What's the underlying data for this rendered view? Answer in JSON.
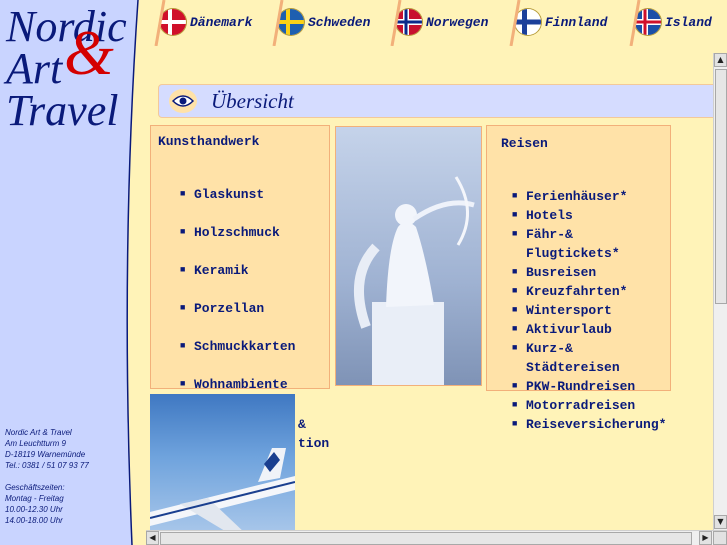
{
  "logo": {
    "line1": "Nordic",
    "line2": "Art",
    "ampersand": "&",
    "line3": "Travel"
  },
  "tabs": [
    {
      "label": "Dänemark",
      "flag": "denmark-flag-icon"
    },
    {
      "label": "Schweden",
      "flag": "sweden-flag-icon"
    },
    {
      "label": "Norwegen",
      "flag": "norway-flag-icon"
    },
    {
      "label": "Finnland",
      "flag": "finland-flag-icon"
    },
    {
      "label": "Island",
      "flag": "iceland-flag-icon"
    }
  ],
  "page_title": "Übersicht",
  "kunsthandwerk": {
    "heading": "Kunsthandwerk",
    "items": [
      "Glaskunst",
      "Holzschmuck",
      "Keramik",
      "Porzellan",
      "Schmuckkarten",
      "Wohnambiente"
    ],
    "partial_line1": "&",
    "partial_line2": "tion"
  },
  "reisen": {
    "heading": "Reisen",
    "items": [
      [
        "Ferienhäuser*"
      ],
      [
        "Hotels"
      ],
      [
        "Fähr-&",
        "Flugtickets*"
      ],
      [
        "Busreisen"
      ],
      [
        "Kreuzfahrten*"
      ],
      [
        "Wintersport"
      ],
      [
        "Aktivurlaub"
      ],
      [
        "Kurz-&",
        "Städtereisen"
      ],
      [
        "PKW-Rundreisen"
      ],
      [
        "Motorradreisen"
      ],
      [
        "Reiseversicherung*"
      ]
    ]
  },
  "contact": {
    "name": "Nordic Art & Travel",
    "street": "Am Leuchtturm 9",
    "city": "D-18119 Warnemünde",
    "phone": "Tel.: 0381 / 51 07 93 77",
    "hours_label": "Geschäftszeiten:",
    "days": "Montag - Freitag",
    "hours1": "10.00-12.30 Uhr",
    "hours2": "14.00-18.00 Uhr"
  },
  "colors": {
    "accent": "#0a1a7a",
    "logo_amp": "#d40000",
    "background": "#fff3b8",
    "panel": "#ffe2a8",
    "sidebar": "#c9d4ff"
  }
}
